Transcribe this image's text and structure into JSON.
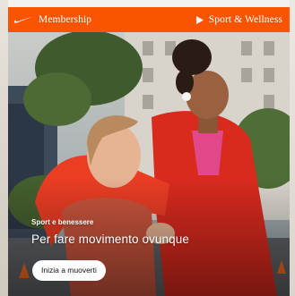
{
  "header": {
    "membership_label": "Membership",
    "sport_label": "Sport & Wellness",
    "icons": {
      "brand": "nike-swoosh-icon",
      "link": "play-arrow-icon"
    }
  },
  "promo": {
    "eyebrow": "Sport e benessere",
    "headline": "Per fare movimento ovunque",
    "cta_label": "Inizia a muoverti"
  },
  "colors": {
    "brand_orange": "#fa5400",
    "cta_bg": "#ffffff",
    "text_light": "#ffffff"
  }
}
